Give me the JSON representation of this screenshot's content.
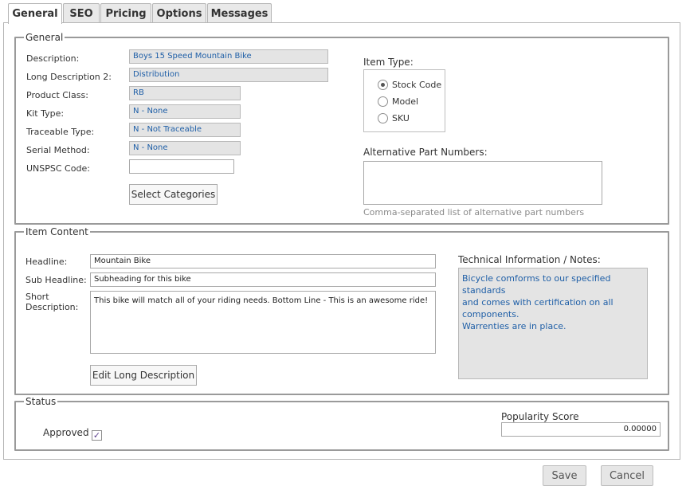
{
  "tabs": [
    {
      "label": "General",
      "active": true
    },
    {
      "label": "SEO",
      "active": false
    },
    {
      "label": "Pricing",
      "active": false
    },
    {
      "label": "Options",
      "active": false
    },
    {
      "label": "Messages",
      "active": false
    }
  ],
  "general": {
    "legend": "General",
    "fields": {
      "description": {
        "label": "Description:",
        "value": "Boys 15 Speed Mountain Bike"
      },
      "long_description_2": {
        "label": "Long Description 2:",
        "value": "Distribution"
      },
      "product_class": {
        "label": "Product Class:",
        "value": "RB"
      },
      "kit_type": {
        "label": "Kit Type:",
        "value": "N - None"
      },
      "traceable_type": {
        "label": "Traceable Type:",
        "value": "N - Not Traceable"
      },
      "serial_method": {
        "label": "Serial Method:",
        "value": "N - None"
      },
      "unspsc_code": {
        "label": "UNSPSC Code:",
        "value": ""
      }
    },
    "select_categories_label": "Select Categories",
    "item_type": {
      "label": "Item Type:",
      "options": [
        {
          "label": "Stock Code",
          "checked": true
        },
        {
          "label": "Model",
          "checked": false
        },
        {
          "label": "SKU",
          "checked": false
        }
      ]
    },
    "alt_part_numbers": {
      "label": "Alternative Part Numbers:",
      "value": "",
      "hint": "Comma-separated list of alternative part numbers"
    }
  },
  "item_content": {
    "legend": "Item Content",
    "headline": {
      "label": "Headline:",
      "value": "Mountain Bike"
    },
    "sub_headline": {
      "label": "Sub Headline:",
      "value": "Subheading for this bike"
    },
    "short_description": {
      "label_line1": "Short",
      "label_line2": "Description:",
      "value": "This bike will match all of your riding needs. Bottom Line - This is an awesome ride!"
    },
    "edit_long_description_label": "Edit Long Description",
    "technical_notes": {
      "label": "Technical Information / Notes:",
      "line1": "Bicycle comforms to our specified standards",
      "line2": "and comes with certification on all",
      "line3": "components.",
      "line4": "Warrenties are in place."
    }
  },
  "status": {
    "legend": "Status",
    "approved_label": "Approved",
    "approved": true,
    "popularity_label": "Popularity Score",
    "popularity_value": "0.00000"
  },
  "actions": {
    "save_label": "Save",
    "cancel_label": "Cancel"
  },
  "colors": {
    "value_text": "#1f5fa7",
    "checkmark": "#5b3f8c"
  },
  "icons": {
    "checkmark": "check-icon"
  }
}
